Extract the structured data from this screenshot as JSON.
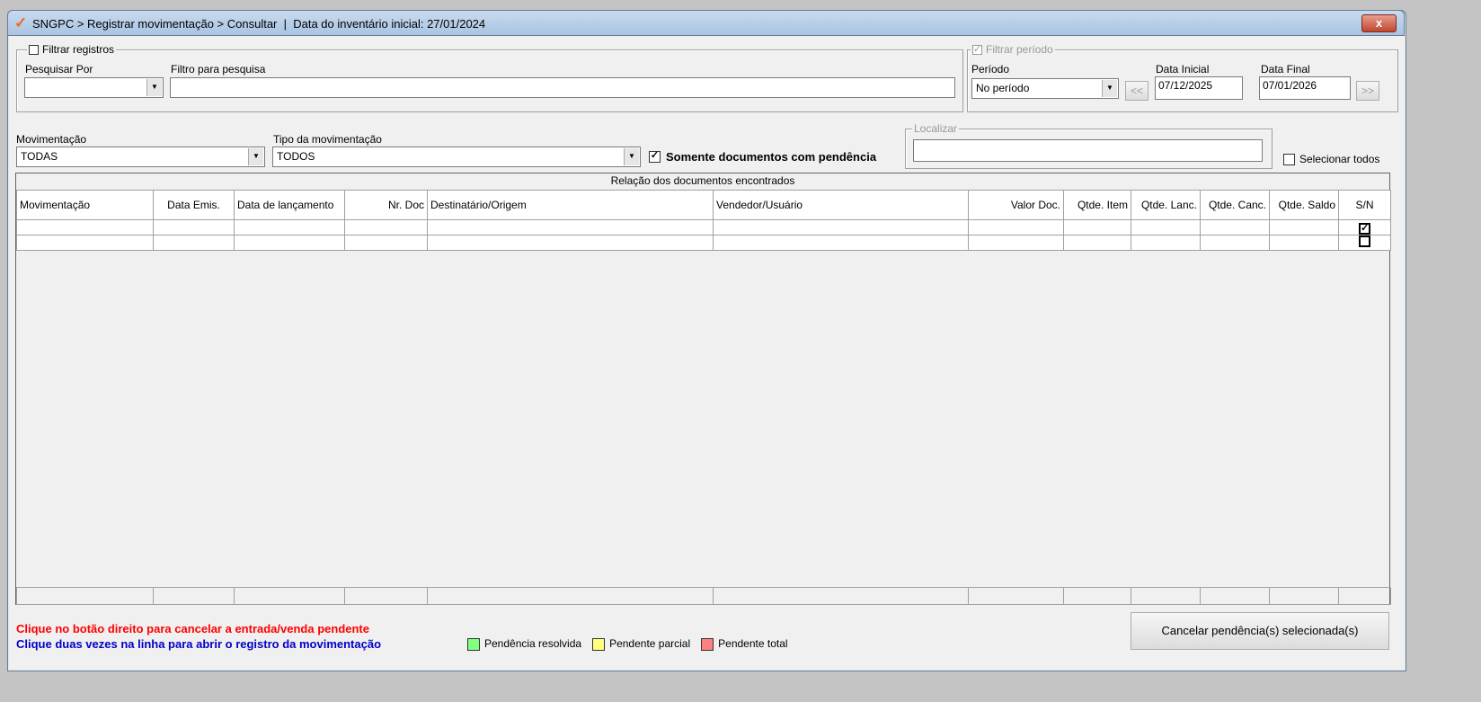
{
  "window": {
    "title": "SNGPC > Registrar movimentação > Consultar  |  Data do inventário inicial: 27/01/2024",
    "close": "x"
  },
  "filtro": {
    "label": "Filtrar registros",
    "checked": false,
    "pesquisar_por": "Pesquisar Por",
    "pesquisar_value": "",
    "filtro_label": "Filtro para pesquisa",
    "filtro_value": ""
  },
  "periodo": {
    "label": "Filtrar período",
    "checked": true,
    "periodo_label": "Período",
    "periodo_value": "No período",
    "data_inicial_label": "Data Inicial",
    "data_inicial": "07/12/2025",
    "data_final_label": "Data Final",
    "data_final": "07/01/2026",
    "prev": "<<",
    "next": ">>"
  },
  "mov": {
    "label": "Movimentação",
    "value": "TODAS",
    "tipo_label": "Tipo da movimentação",
    "tipo_value": "TODOS",
    "pendencia_label": "Somente documentos com pendência",
    "pendencia_checked": true
  },
  "localizar": {
    "label": "Localizar",
    "value": ""
  },
  "selecionar_todos": "Selecionar todos",
  "grid": {
    "caption": "Relação dos documentos encontrados",
    "columns": [
      "Movimentação",
      "Data Emis.",
      "Data de lançamento",
      "Nr. Doc",
      "Destinatário/Origem",
      "Vendedor/Usuário",
      "Valor Doc.",
      "Qtde. Item",
      "Qtde. Lanc.",
      "Qtde. Canc.",
      "Qtde. Saldo",
      "S/N"
    ],
    "rows": [
      {
        "sn": true
      },
      {
        "sn": false
      }
    ]
  },
  "hints": {
    "red": "Clique no botão direito para cancelar a entrada/venda pendente",
    "blue": "Clique duas vezes na linha para abrir o registro da movimentação"
  },
  "legend": [
    {
      "label": "Pendência resolvida",
      "color": "#80ff80"
    },
    {
      "label": "Pendente parcial",
      "color": "#ffff80"
    },
    {
      "label": "Pendente total",
      "color": "#ff8080"
    }
  ],
  "cancel_button": "Cancelar pendência(s) selecionada(s)"
}
